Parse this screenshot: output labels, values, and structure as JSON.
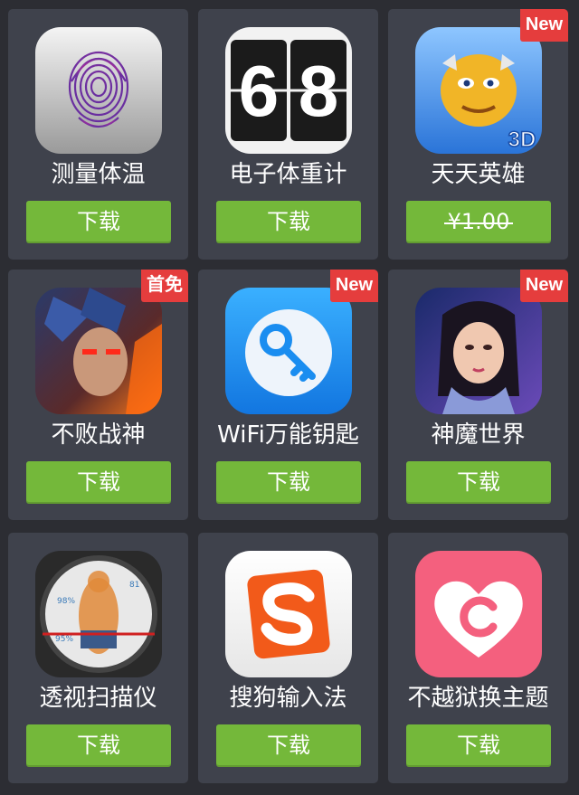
{
  "apps": [
    {
      "name": "测量体温",
      "button": "下载",
      "badge": "",
      "icon": "fingerprint-icon"
    },
    {
      "name": "电子体重计",
      "button": "下载",
      "badge": "",
      "icon": "flip-clock-icon",
      "digits": [
        "6",
        "8"
      ]
    },
    {
      "name": "天天英雄",
      "button": "¥1.00",
      "badge": "New",
      "icon": "hero-game-icon",
      "icon_text": "3D"
    },
    {
      "name": "不败战神",
      "button": "下载",
      "badge": "首免",
      "icon": "warrior-game-icon"
    },
    {
      "name": "WiFi万能钥匙",
      "button": "下载",
      "badge": "New",
      "icon": "wifi-key-icon"
    },
    {
      "name": "神魔世界",
      "button": "下载",
      "badge": "New",
      "icon": "fantasy-girl-icon"
    },
    {
      "name": "透视扫描仪",
      "button": "下载",
      "badge": "",
      "icon": "scanner-icon",
      "icon_text": [
        "98%",
        "95%",
        "81"
      ]
    },
    {
      "name": "搜狗输入法",
      "button": "下载",
      "badge": "",
      "icon": "sogou-s-icon"
    },
    {
      "name": "不越狱换主题",
      "button": "下载",
      "badge": "",
      "icon": "heart-theme-icon"
    }
  ],
  "colors": {
    "background": "#2c2d33",
    "card": "#3f424c",
    "button": "#74b83a",
    "badge": "#e53d3d"
  }
}
